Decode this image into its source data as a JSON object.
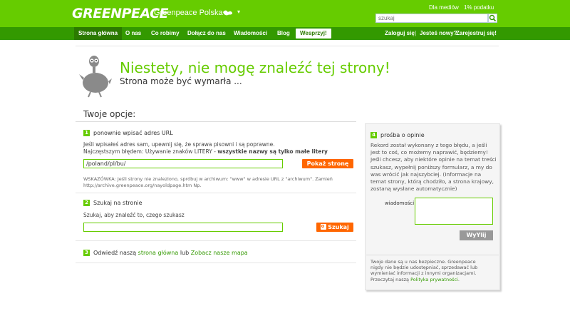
{
  "header": {
    "logo": "GREENPEACE",
    "site_name": "Greenpeace Polska",
    "top_link_media": "Dla mediów",
    "top_link_tax": "1% podatku",
    "search_placeholder": "szukaj"
  },
  "nav": {
    "items": [
      {
        "label": "Strona główna"
      },
      {
        "label": "O nas"
      },
      {
        "label": "Co robimy"
      },
      {
        "label": "Dołącz do nas"
      },
      {
        "label": "Wiadomości"
      },
      {
        "label": "Blog"
      },
      {
        "label": "Wesprzyj!"
      }
    ],
    "login": "Zaloguj się",
    "separator": "|",
    "new_prompt": "Jesteś nowy?",
    "register": "Zarejestruj się!"
  },
  "title": {
    "heading": "Niestety, nie mogę znaleźć tej strony!",
    "subheading": "Strona może być wymarła ..."
  },
  "options": {
    "title": "Twoje opcje:",
    "step1": {
      "num": "1",
      "label": "ponownie wpisać adres URL",
      "line1": "Jeśli wpisałeś adres sam, upewnij się, że sprawa pisowni i są poprawne.",
      "line2_prefix": "Najczęstszym błędem: Używanie znaków LITERY - ",
      "line2_bold": "wszystkie nazwy są tylko małe litery",
      "url_value": "/poland/pl/bu/",
      "button": "Pokaż stronę",
      "hint1": "WSKAZÓWKA: Jeśli strony nie znaleziono, spróbuj w archiwum: \"www\" w adresie URL z \"archiwum\". Zamień",
      "hint2": "http://archive.greenpeace.org/nayoldpage.htm Np."
    },
    "step2": {
      "num": "2",
      "label": "Szukaj na stronie",
      "line": "Szukaj, aby znaleźć to, czego szukasz",
      "search_value": "",
      "button": "Szukaj"
    },
    "step3": {
      "num": "3",
      "prefix": "Odwiedź naszą",
      "link1": "strona główna",
      "middle": "lub",
      "link2": "Zobacz nasze mapa"
    }
  },
  "panel": {
    "num": "4",
    "label": "prośba o opinie",
    "body": [
      "Rekord został wykonany z tego błędu, a jeśli",
      "jest to coś, co możemy naprawić, będziemy!",
      "Jeśli chcesz, aby niektóre opinie na temat treści",
      "szukasz, wypełnij poniższy formularz, a my do",
      "was wrócić jak najszybciej. (Informacje na",
      "temat strony, którą chodziło, a strona krajowy,",
      "zostaną wysłane automatycznie)"
    ],
    "field_label": "wiadomości",
    "message_value": "",
    "send_button": "WyYlij",
    "footer1": "Twoje dane są u nas bezpieczne. Greenpeace",
    "footer2": "nigdy nie będzie udostępniać, sprzedawać lub",
    "footer3": "wymieniać informacji z innymi organizacjami.",
    "footer4_prefix": "Przeczytaj naszą",
    "footer4_link": "Polityka prywatności"
  },
  "colors": {
    "header_green": "#66cc00",
    "nav_green": "#339900",
    "accent_orange": "#ff6600"
  }
}
